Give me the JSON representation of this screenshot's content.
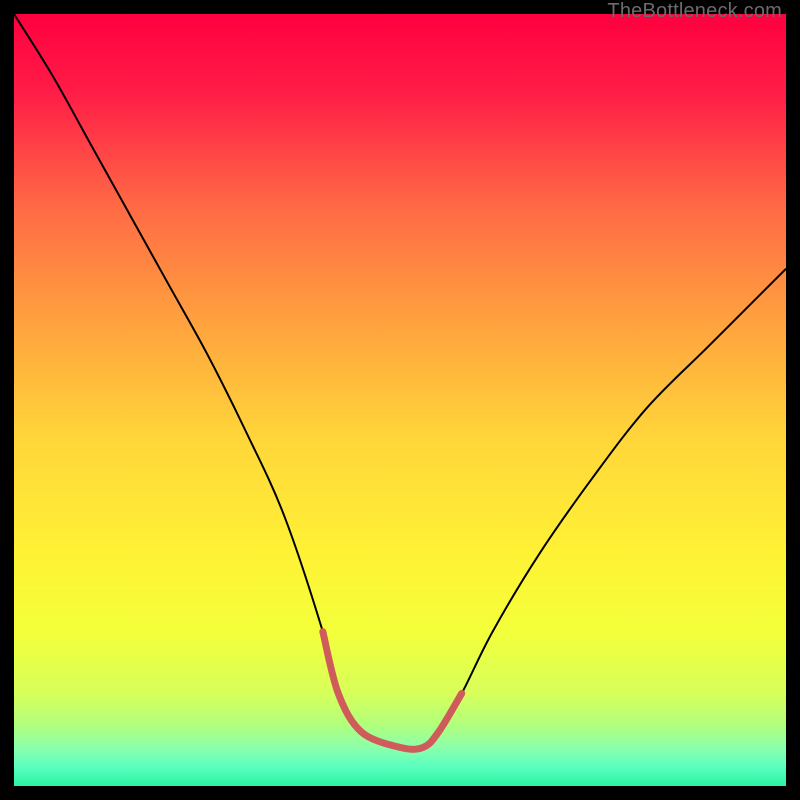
{
  "watermark": "TheBottleneck.com",
  "chart_data": {
    "type": "line",
    "title": "",
    "xlabel": "",
    "ylabel": "",
    "xlim": [
      0,
      100
    ],
    "ylim": [
      0,
      100
    ],
    "grid": false,
    "legend": false,
    "background": {
      "type": "vertical-gradient",
      "stops": [
        {
          "pos": 0.0,
          "color": "#ff003f"
        },
        {
          "pos": 0.1,
          "color": "#ff1c47"
        },
        {
          "pos": 0.25,
          "color": "#ff6a45"
        },
        {
          "pos": 0.4,
          "color": "#ffa23e"
        },
        {
          "pos": 0.55,
          "color": "#ffd63a"
        },
        {
          "pos": 0.7,
          "color": "#fff235"
        },
        {
          "pos": 0.8,
          "color": "#f3ff3a"
        },
        {
          "pos": 0.88,
          "color": "#d7ff5a"
        },
        {
          "pos": 0.92,
          "color": "#b2ff7b"
        },
        {
          "pos": 0.95,
          "color": "#8cffab"
        },
        {
          "pos": 0.975,
          "color": "#5affc0"
        },
        {
          "pos": 1.0,
          "color": "#2bf3a0"
        }
      ]
    },
    "series": [
      {
        "name": "bottleneck-curve",
        "color": "#000000",
        "stroke_width": 2,
        "x": [
          0,
          5,
          10,
          15,
          20,
          25,
          30,
          35,
          40,
          42,
          45,
          50,
          53,
          55,
          58,
          62,
          68,
          75,
          82,
          90,
          98,
          100
        ],
        "y": [
          100,
          92,
          83,
          74,
          65,
          56,
          46,
          35,
          20,
          12,
          7,
          5,
          5,
          7,
          12,
          20,
          30,
          40,
          49,
          57,
          65,
          67
        ]
      },
      {
        "name": "bottleneck-flat-marker",
        "color": "#cf5b5b",
        "stroke_width": 7,
        "linecap": "round",
        "x": [
          40,
          42,
          45,
          50,
          53,
          55,
          58
        ],
        "y": [
          20,
          12,
          7,
          5,
          5,
          7,
          12
        ]
      }
    ]
  }
}
